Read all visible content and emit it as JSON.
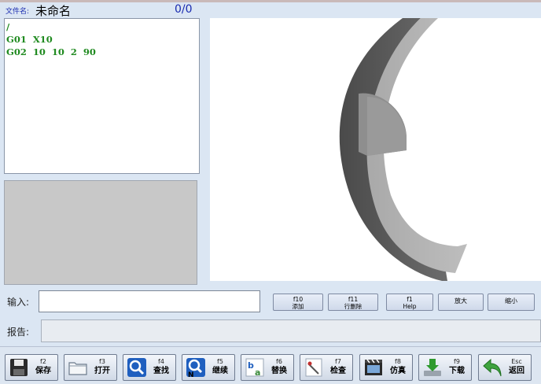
{
  "header": {
    "file_label": "文件名:",
    "file_name": "未命名",
    "line_counter": "0/0"
  },
  "code": {
    "lines": [
      "/",
      "G01  X10",
      "G02  10  10  2  90"
    ]
  },
  "input": {
    "label": "输入:",
    "value": ""
  },
  "report": {
    "label": "报告:",
    "value": ""
  },
  "small_buttons": [
    {
      "key": "f10",
      "label": "添加"
    },
    {
      "key": "f11",
      "label": "行删除"
    },
    {
      "key": "f1",
      "label": "Help"
    },
    {
      "key": "",
      "label": "放大"
    },
    {
      "key": "",
      "label": "缩小"
    }
  ],
  "toolbar": [
    {
      "key": "f2",
      "label": "保存",
      "icon": "save-icon"
    },
    {
      "key": "f3",
      "label": "打开",
      "icon": "folder-icon"
    },
    {
      "key": "f4",
      "label": "查找",
      "icon": "search-icon"
    },
    {
      "key": "f5",
      "label": "继续",
      "icon": "find-next-icon"
    },
    {
      "key": "f6",
      "label": "替换",
      "icon": "replace-icon"
    },
    {
      "key": "f7",
      "label": "检查",
      "icon": "check-icon"
    },
    {
      "key": "f8",
      "label": "仿真",
      "icon": "film-icon"
    },
    {
      "key": "f9",
      "label": "下载",
      "icon": "download-icon"
    },
    {
      "key": "Esc",
      "label": "返回",
      "icon": "back-arrow-icon"
    }
  ],
  "colors": {
    "code_text": "#1f8a1f",
    "header_blue": "#1a2bb0",
    "background": "#dbe6f3"
  }
}
